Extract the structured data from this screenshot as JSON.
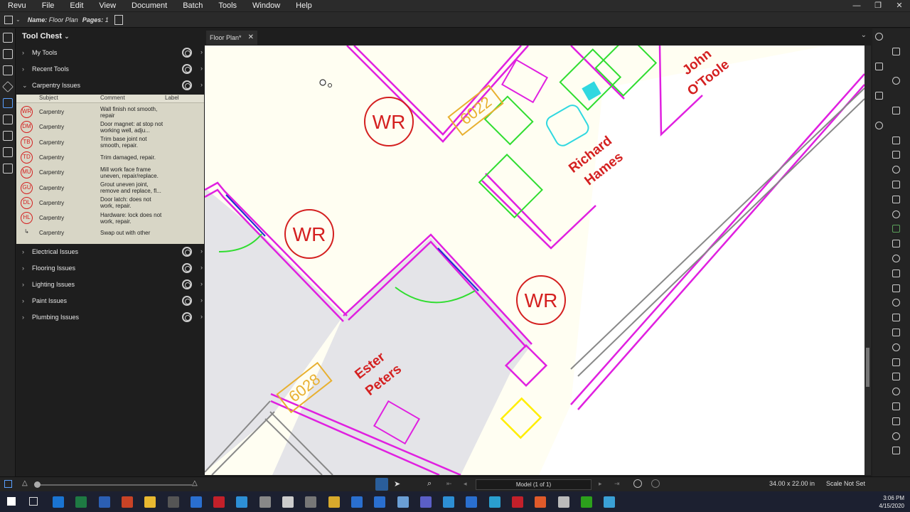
{
  "menu": [
    "Revu",
    "File",
    "Edit",
    "View",
    "Document",
    "Batch",
    "Tools",
    "Window",
    "Help"
  ],
  "docbar": {
    "name_label": "Name:",
    "name_value": "Floor Plan",
    "pages_label": "Pages:",
    "pages_value": "1"
  },
  "panel": {
    "title": "Tool Chest",
    "sections_top": [
      {
        "label": "My Tools"
      },
      {
        "label": "Recent Tools"
      },
      {
        "label": "Carpentry Issues"
      }
    ],
    "columns": [
      "Subject",
      "Comment",
      "Label"
    ],
    "rows": [
      {
        "badge": "WR",
        "subject": "Carpentry",
        "comment": "Wall finish not smooth, repair"
      },
      {
        "badge": "DM",
        "subject": "Carpentry",
        "comment": "Door magnet: at stop not working well, adju..."
      },
      {
        "badge": "TB",
        "subject": "Carpentry",
        "comment": "Trim base joint not smooth, repair."
      },
      {
        "badge": "TD",
        "subject": "Carpentry",
        "comment": "Trim damaged, repair."
      },
      {
        "badge": "MU",
        "subject": "Carpentry",
        "comment": "Mill work face frame uneven, repair/replace."
      },
      {
        "badge": "GU",
        "subject": "Carpentry",
        "comment": "Grout uneven joint, remove and replace, fl..."
      },
      {
        "badge": "DL",
        "subject": "Carpentry",
        "comment": "Door latch: does not work, repair."
      },
      {
        "badge": "HL",
        "subject": "Carpentry",
        "comment": "Hardware: lock does not work, repair."
      },
      {
        "badge": "",
        "subject": "Carpentry",
        "comment": "Swap out with other"
      }
    ],
    "sections_bottom": [
      {
        "label": "Electrical Issues"
      },
      {
        "label": "Flooring Issues"
      },
      {
        "label": "Lighting Issues"
      },
      {
        "label": "Paint Issues"
      },
      {
        "label": "Plumbing Issues"
      }
    ]
  },
  "tab": {
    "label": "Floor Plan*"
  },
  "drawing": {
    "markups": [
      "WR",
      "WR",
      "WR"
    ],
    "doors": [
      "6022",
      "6028"
    ],
    "names": [
      "John",
      "O'Toole",
      "Richard",
      "Hames",
      "Ester",
      "Peters"
    ]
  },
  "status": {
    "page": "Model (1 of 1)",
    "size": "34.00 x 22.00 in",
    "scale": "Scale Not Set"
  },
  "clock": {
    "time": "3:06 PM",
    "date": "4/15/2020"
  },
  "colors": {
    "markup_red": "#d42020",
    "wall_magenta": "#e020e0",
    "furniture_green": "#30dd30",
    "door_orange": "#e8b030"
  }
}
